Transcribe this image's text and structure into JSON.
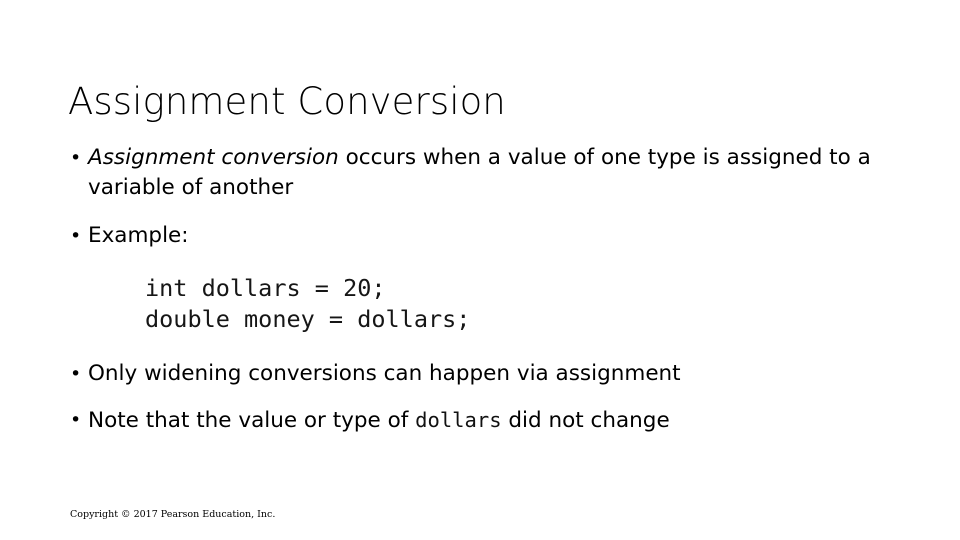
{
  "slide": {
    "title": "Assignment Conversion",
    "background_color": "#ffffff",
    "text_color": "#000000"
  },
  "bullets": [
    {
      "id": "assignment-conversion-definition",
      "emphasis": "Assignment conversion",
      "rest": " occurs when a value of one type is assigned to a variable of another",
      "full_text": "Assignment conversion occurs when a value of one type is assigned to a variable of another"
    },
    {
      "id": "example-label",
      "full_text": "Example:"
    },
    {
      "id": "widening-conversions-note",
      "full_text": "Only widening conversions can happen via assignment"
    },
    {
      "id": "dollars-unchanged-note",
      "prefix": "Note that the value or type of ",
      "code": "dollars",
      "suffix": " did not change",
      "full_text": "Note that the value or type of dollars did not change"
    }
  ],
  "code_block": {
    "language": "java",
    "line1": "int dollars = 20;",
    "line2": "double money = dollars;",
    "text": "int dollars = 20;\ndouble money = dollars;"
  },
  "footer": {
    "copyright": "Copyright © 2017 Pearson Education, Inc."
  }
}
